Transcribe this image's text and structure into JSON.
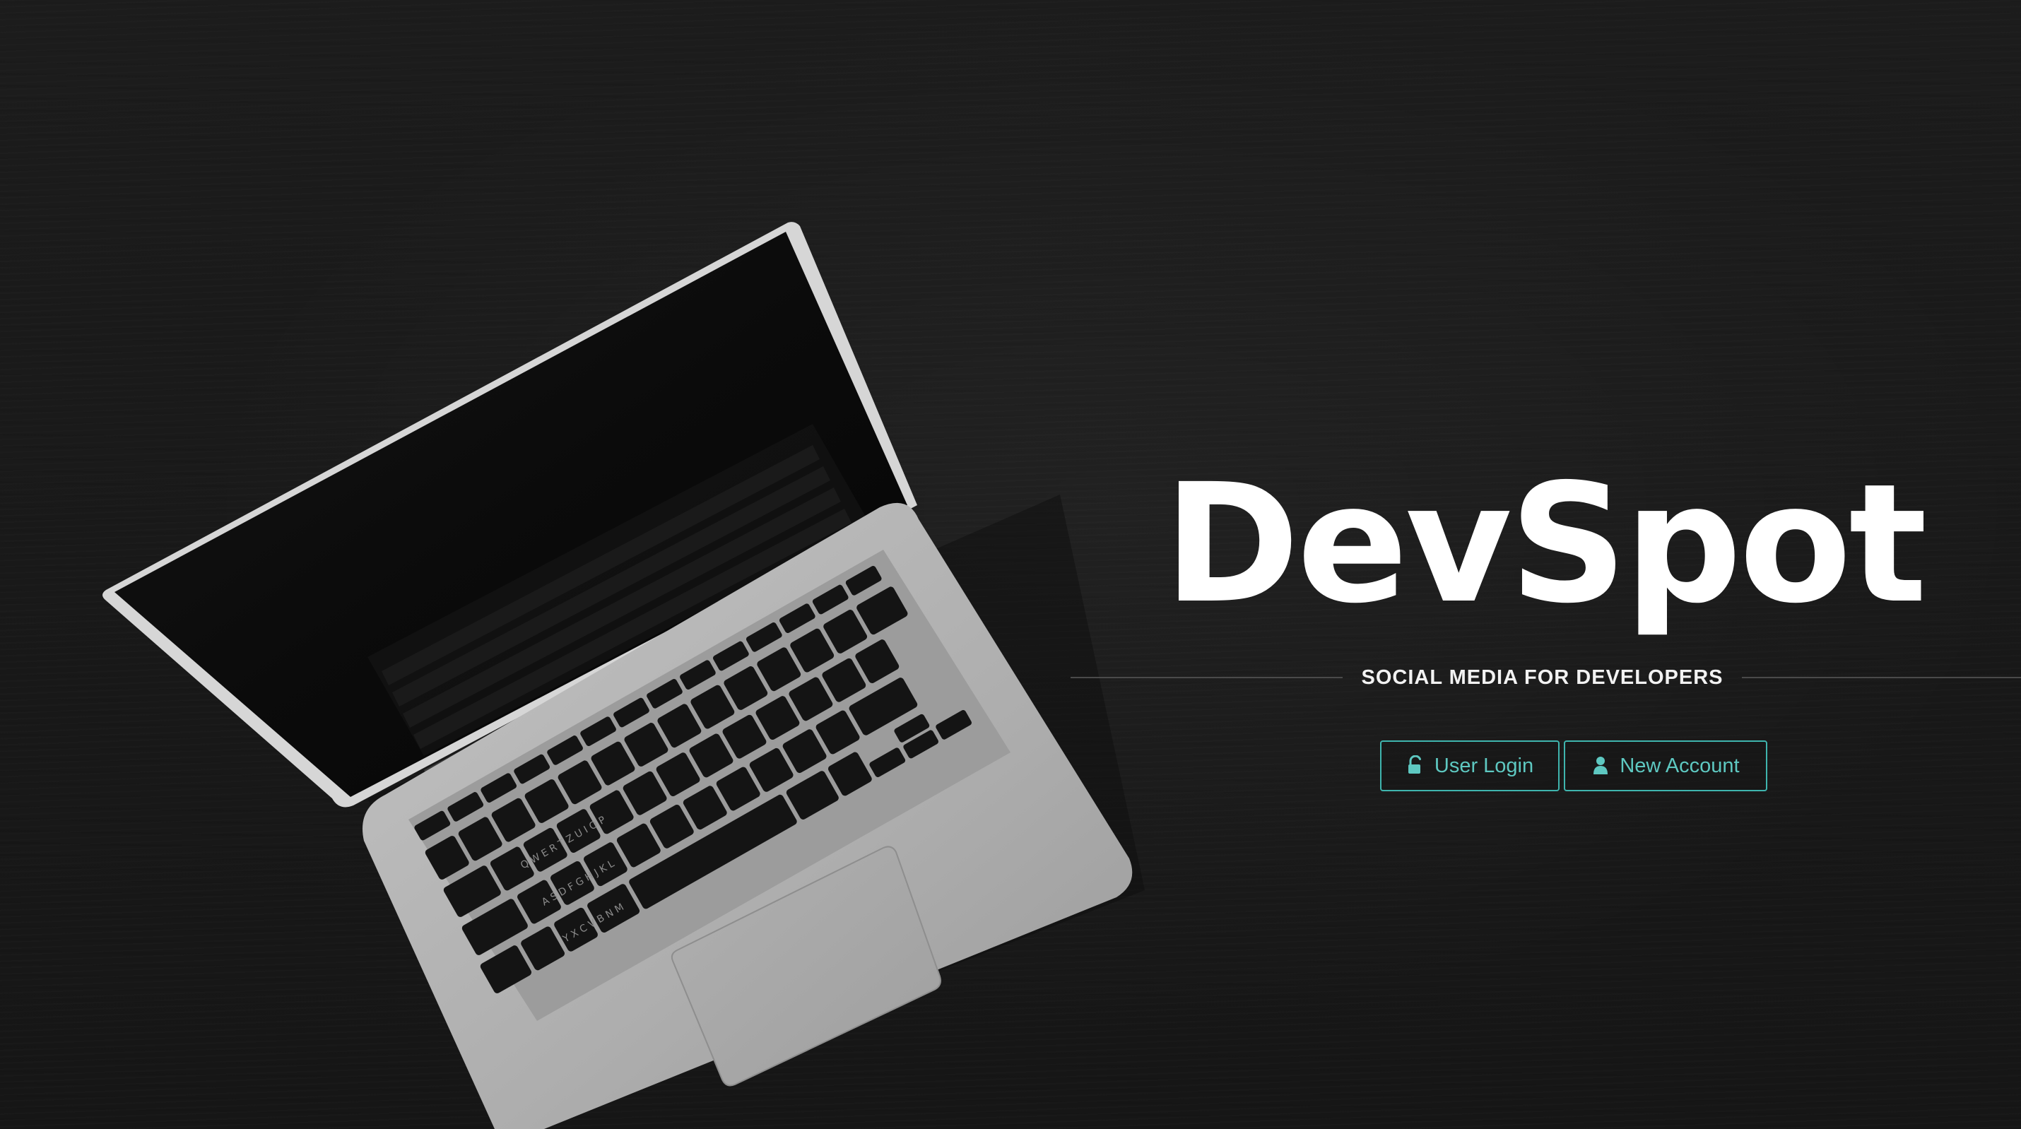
{
  "brand": {
    "title": "DevSpot",
    "tagline": "SOCIAL MEDIA FOR DEVELOPERS"
  },
  "actions": {
    "login_label": "User Login",
    "login_icon": "unlock-icon",
    "new_account_label": "New Account",
    "new_account_icon": "user-icon"
  },
  "colors": {
    "background": "#1a1a1a",
    "accent": "#3fb5ae",
    "title": "#ffffff"
  }
}
